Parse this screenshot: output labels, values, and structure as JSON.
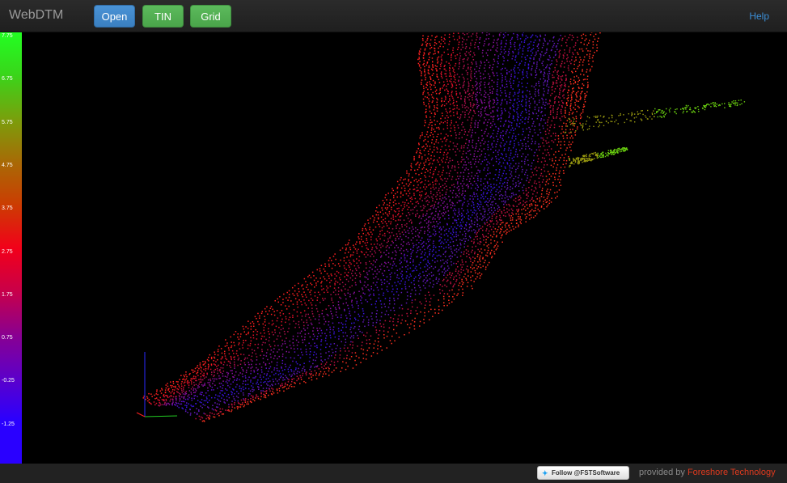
{
  "navbar": {
    "brand": "WebDTM",
    "buttons": {
      "open": "Open",
      "tin": "TIN",
      "grid": "Grid"
    },
    "help": "Help"
  },
  "legend": {
    "labels": [
      "7.75",
      "6.75",
      "5.75",
      "4.75",
      "3.75",
      "2.75",
      "1.75",
      "0.75",
      "-0.25",
      "-1.25"
    ],
    "colors": [
      "#22ff22",
      "#3ad41a",
      "#7a9f0c",
      "#a86a06",
      "#cc3c02",
      "#f2001a",
      "#c8004a",
      "#8a0090",
      "#5e00c8",
      "#2a00ff"
    ]
  },
  "footer": {
    "follow": "Follow @FSTSoftware",
    "provided_by": "provided by",
    "company": "Foreshore Technology"
  },
  "colors": {
    "accent": "#3b8ed6",
    "brand_red": "#e03a1e"
  },
  "icons": {
    "twitter": "twitter-bird-icon"
  }
}
